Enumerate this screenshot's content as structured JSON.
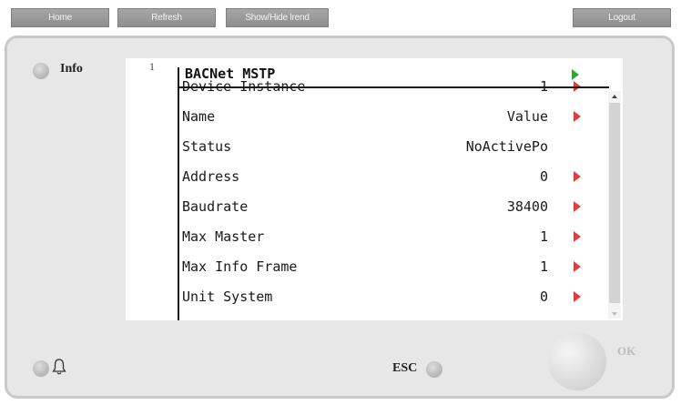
{
  "toolbar": {
    "home": "Home",
    "refresh": "Refresh",
    "legend": "Show/Hide lrend",
    "logout": "Logout"
  },
  "panel": {
    "info_label": "Info",
    "esc_label": "ESC",
    "ok_label": "OK"
  },
  "screen": {
    "line_number": "1",
    "title": "BACNet MSTP",
    "rows": [
      {
        "label": "Device Instance",
        "value": "1",
        "arrow": true
      },
      {
        "label": "Name",
        "value": "Value",
        "arrow": true
      },
      {
        "label": "Status",
        "value": "NoActivePo",
        "arrow": false
      },
      {
        "label": "Address",
        "value": "0",
        "arrow": true
      },
      {
        "label": "Baudrate",
        "value": "38400",
        "arrow": true
      },
      {
        "label": "Max Master",
        "value": "1",
        "arrow": true
      },
      {
        "label": "Max Info Frame",
        "value": "1",
        "arrow": true
      },
      {
        "label": "Unit System",
        "value": "0",
        "arrow": true
      }
    ]
  },
  "colors": {
    "title_arrow": "#2fa82f",
    "row_arrow": "#e43c3c",
    "button_bg": "#9a9a9a",
    "panel_bg": "#e7e7e7"
  },
  "icons": {
    "title_arrow": "play-green-icon",
    "row_arrow": "play-red-icon",
    "alarm": "bell-icon"
  }
}
